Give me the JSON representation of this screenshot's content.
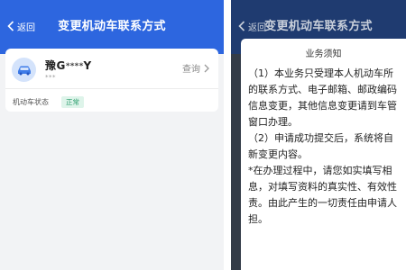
{
  "left_screen": {
    "header": {
      "back_label": "返回",
      "title": "变更机动车联系方式"
    },
    "vehicle_card": {
      "plate_prefix": "豫G",
      "plate_mask": "****",
      "plate_suffix": "Y",
      "phone_mask": "***",
      "query_label": "查询",
      "status_label": "机动车状态",
      "status_value": "正常"
    }
  },
  "right_screen": {
    "header": {
      "back_label": "返回",
      "title": "变更机动车联系方式"
    },
    "notice": {
      "title": "业务须知",
      "lines": [
        "（1）本业务只受理本人机动车所",
        "的联系方式、电子邮箱、邮政编码",
        "信息变更，其他信息变更请到车管",
        "窗口办理。",
        "（2）申请成功提交后，系统将自",
        "新变更内容。",
        "*在办理过程中，请您如实填写相",
        "息，对填写资料的真实性、有效性",
        "责。由此产生的一切责任由申请人",
        "担。"
      ]
    }
  },
  "colors": {
    "header_blue": "#2d66df",
    "status_green": "#2a9d6c",
    "overlay_dark": "#333b47"
  }
}
